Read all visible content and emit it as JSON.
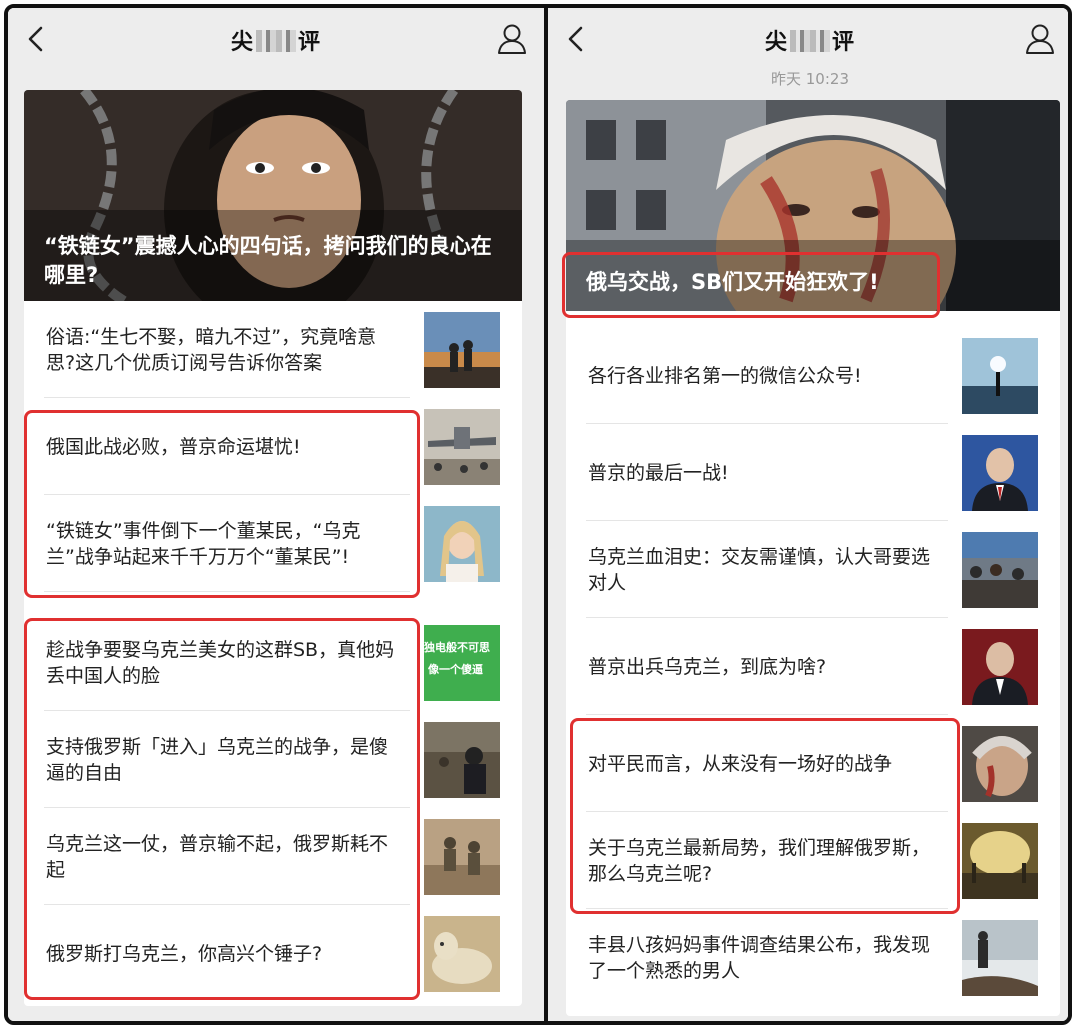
{
  "left": {
    "title_prefix": "尖",
    "title_suffix": "评",
    "timestamp": "",
    "hero_title": "“铁链女”震撼人心的四句话，拷问我们的良心在哪里?",
    "items": [
      {
        "title": "俗语:“生七不娶，暗九不过”，究竟啥意思?这几个优质订阅号告诉你答案"
      },
      {
        "title": "俄国此战必败，普京命运堪忧!"
      },
      {
        "title": "“铁链女”事件倒下一个董某民，“乌克兰”战争站起来千千万万个“董某民”!"
      },
      {
        "title": "趁战争要娶乌克兰美女的这群SB，真他妈丢中国人的脸",
        "thumb_text": [
          "独电般不可思",
          "像一个傻逼"
        ]
      },
      {
        "title": "支持俄罗斯「进入」乌克兰的战争，是傻逼的自由"
      },
      {
        "title": "乌克兰这一仗，普京输不起，俄罗斯耗不起"
      },
      {
        "title": "俄罗斯打乌克兰，你高兴个锤子?"
      }
    ]
  },
  "right": {
    "title_prefix": "尖",
    "title_suffix": "评",
    "timestamp": "昨天 10:23",
    "hero_title": "俄乌交战，SB们又开始狂欢了!",
    "items": [
      {
        "title": "各行各业排名第一的微信公众号!"
      },
      {
        "title": "普京的最后一战!"
      },
      {
        "title": "乌克兰血泪史：交友需谨慎，认大哥要选对人"
      },
      {
        "title": "普京出兵乌克兰，到底为啥?"
      },
      {
        "title": "对平民而言，从来没有一场好的战争"
      },
      {
        "title": "关于乌克兰最新局势，我们理解俄罗斯，那么乌克兰呢?"
      },
      {
        "title": "丰县八孩妈妈事件调查结果公布，我发现了一个熟悉的男人"
      }
    ]
  },
  "colors": {
    "highlight": "#e03030",
    "background": "#ededed",
    "card": "#ffffff"
  }
}
